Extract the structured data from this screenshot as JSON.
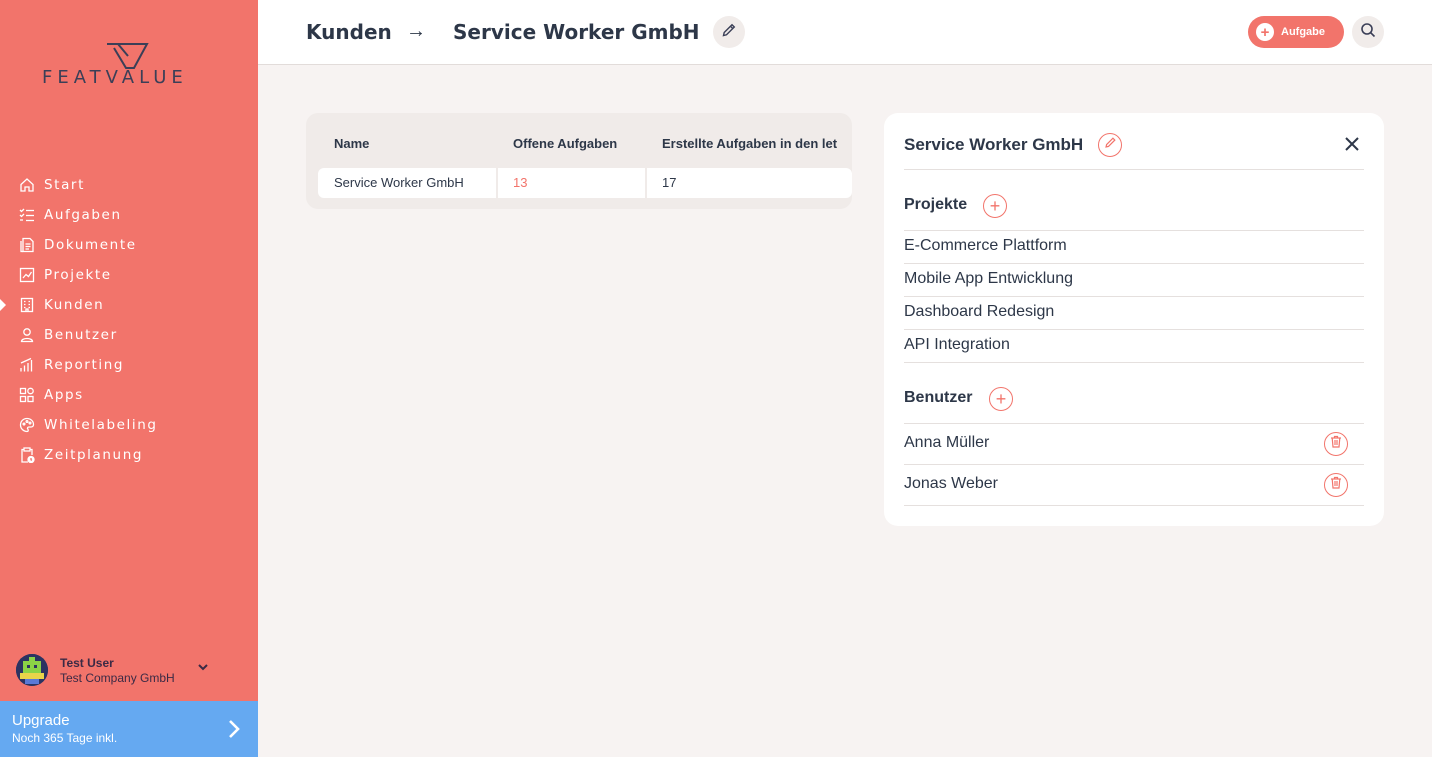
{
  "app": {
    "logo_text": "FEATVALUE"
  },
  "sidebar": {
    "items": [
      {
        "label": "Start",
        "icon": "home-icon"
      },
      {
        "label": "Aufgaben",
        "icon": "checklist-icon"
      },
      {
        "label": "Dokumente",
        "icon": "document-icon"
      },
      {
        "label": "Projekte",
        "icon": "chart-icon"
      },
      {
        "label": "Kunden",
        "icon": "building-icon",
        "active": true
      },
      {
        "label": "Benutzer",
        "icon": "user-icon"
      },
      {
        "label": "Reporting",
        "icon": "bar-chart-icon"
      },
      {
        "label": "Apps",
        "icon": "apps-icon"
      },
      {
        "label": "Whitelabeling",
        "icon": "palette-icon"
      },
      {
        "label": "Zeitplanung",
        "icon": "clipboard-clock-icon"
      }
    ],
    "user": {
      "name": "Test User",
      "company": "Test Company GmbH"
    },
    "upgrade": {
      "title": "Upgrade",
      "subtitle": "Noch 365 Tage inkl."
    }
  },
  "header": {
    "breadcrumb_root": "Kunden",
    "breadcrumb_arrow": "→",
    "breadcrumb_current": "Service Worker GmbH",
    "task_button": "Aufgabe"
  },
  "table": {
    "columns": [
      "Name",
      "Offene Aufgaben",
      "Erstellte Aufgaben in den let"
    ],
    "rows": [
      {
        "name": "Service Worker GmbH",
        "open": "13",
        "created": "17"
      }
    ]
  },
  "panel": {
    "title": "Service Worker GmbH",
    "projects_title": "Projekte",
    "projects": [
      "E-Commerce Plattform",
      "Mobile App Entwicklung",
      "Dashboard Redesign",
      "API Integration"
    ],
    "users_title": "Benutzer",
    "users": [
      "Anna Müller",
      "Jonas Weber"
    ]
  },
  "colors": {
    "accent": "#f2746b",
    "upgrade": "#65a9f1",
    "text": "#2d3748"
  }
}
